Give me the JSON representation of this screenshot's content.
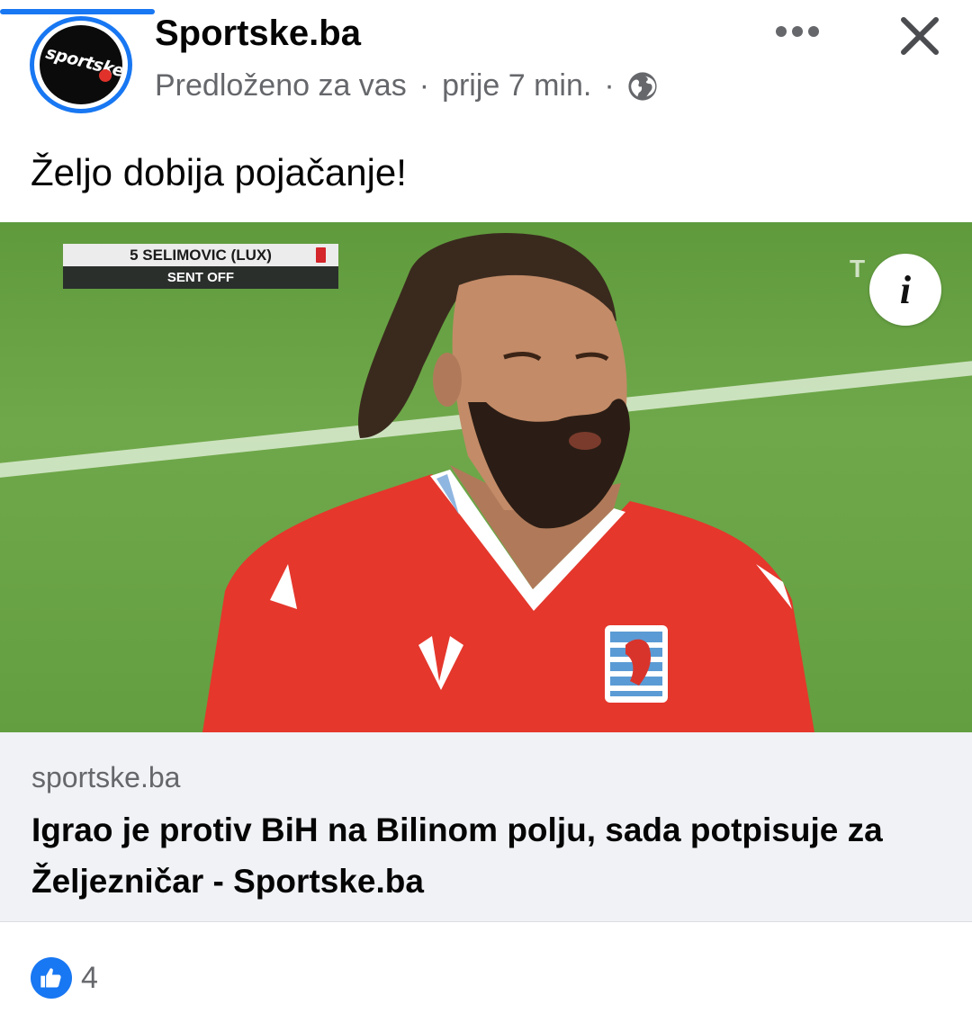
{
  "post": {
    "page_name": "Sportske.ba",
    "avatar_text": "sportske",
    "meta": {
      "suggested": "Predloženo za vas",
      "separator": "·",
      "time": "prije 7 min.",
      "separator2": "·",
      "audience_icon": "globe-icon"
    },
    "text": "Željo dobija pojačanje!",
    "actions": {
      "more_icon": "more-dots-icon",
      "close_icon": "close-icon"
    }
  },
  "media": {
    "overlay": {
      "player": "5 SELIMOVIC (LUX)",
      "status": "SENT OFF"
    },
    "tv_logo": "T  ",
    "info_glyph": "i"
  },
  "link_preview": {
    "domain": "sportske.ba",
    "title": "Igrao je protiv BiH na Bilinom polju, sada potpisuje za Željezničar - Sportske.ba"
  },
  "reactions": {
    "icon": "like-icon",
    "count": "4"
  },
  "colors": {
    "accent": "#1877f2",
    "secondary_text": "#65676b",
    "link_bg": "#f0f2f5"
  }
}
